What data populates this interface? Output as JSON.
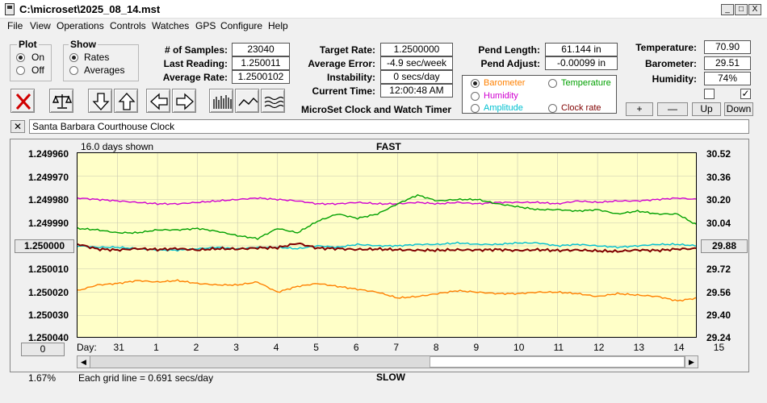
{
  "window": {
    "title": "C:\\microset\\2025_08_14.mst",
    "min": "_",
    "max": "□",
    "close": "X"
  },
  "menu": [
    "File",
    "View",
    "Operations",
    "Controls",
    "Watches",
    "GPS",
    "Configure",
    "Help"
  ],
  "plot_group": {
    "title": "Plot",
    "options": [
      "On",
      "Off"
    ],
    "selected": "On"
  },
  "show_group": {
    "title": "Show",
    "options": [
      "Rates",
      "Averages"
    ],
    "selected": "Rates"
  },
  "stats": {
    "samples_label": "# of Samples:",
    "samples": "23040",
    "last_label": "Last Reading:",
    "last": "1.250011",
    "avg_label": "Average Rate:",
    "avg": "1.2500102",
    "target_label": "Target Rate:",
    "target": "1.2500000",
    "avgerr_label": "Average Error:",
    "avgerr": "-4.9 sec/week",
    "instab_label": "Instability:",
    "instab": "0 secs/day",
    "time_label": "Current Time:",
    "time": "12:00:48 AM",
    "pendlen_label": "Pend Length:",
    "pendlen": "61.144 in",
    "pendadj_label": "Pend Adjust:",
    "pendadj": "-0.00099 in",
    "temp_label": "Temperature:",
    "temp": "70.90",
    "baro_label": "Barometer:",
    "baro": "29.51",
    "hum_label": "Humidity:",
    "hum": "74%"
  },
  "heading": "MicroSet Clock and Watch Timer",
  "series_options": [
    {
      "label": "Barometer",
      "color": "#ff8000",
      "selected": true
    },
    {
      "label": "Temperature",
      "color": "#00a000",
      "selected": false
    },
    {
      "label": "Humidity",
      "color": "#d000d0",
      "selected": false
    },
    {
      "label": "Clock rate",
      "color": "#800000",
      "selected": false
    },
    {
      "label": "Amplitude",
      "color": "#00c0d0",
      "selected": false
    }
  ],
  "adjust_buttons": {
    "plus": "+",
    "minus": "—",
    "up": "Up",
    "down": "Down"
  },
  "checkboxes": {
    "a": "",
    "b": "✓"
  },
  "clock_name": "Santa Barbara Courthouse Clock",
  "clear_btn": "✕",
  "chart": {
    "days_shown": "16.0 days shown",
    "top_label": "FAST",
    "bottom_label": "SLOW",
    "grid_note": "Each grid line = 0.691 secs/day",
    "percent": "1.67%",
    "center_left": "1.250000",
    "center_right": "29.88",
    "zero_btn": "0",
    "day_label": "Day:"
  },
  "chart_data": {
    "type": "line",
    "title": "",
    "y_left_ticks": [
      "1.249960",
      "1.249970",
      "1.249980",
      "1.249990",
      "1.250000",
      "1.250010",
      "1.250020",
      "1.250030",
      "1.250040"
    ],
    "y_right_ticks": [
      "30.52",
      "30.36",
      "30.20",
      "30.04",
      "29.88",
      "29.72",
      "29.56",
      "29.40",
      "29.24"
    ],
    "x_ticks": [
      "31",
      "1",
      "2",
      "3",
      "4",
      "5",
      "6",
      "7",
      "8",
      "9",
      "10",
      "11",
      "12",
      "13",
      "14",
      "15"
    ],
    "x": [
      0,
      0.5,
      1,
      1.5,
      2,
      2.5,
      3,
      3.5,
      4,
      4.5,
      5,
      5.5,
      6,
      6.5,
      7,
      7.5,
      8,
      8.5,
      9,
      9.5,
      10,
      10.5,
      11,
      11.5,
      12,
      12.5,
      13,
      13.5,
      14,
      14.5,
      15,
      15.5
    ],
    "series": [
      {
        "name": "Clock rate",
        "color": "#800000",
        "values": [
          1.2499992,
          1.2500014,
          1.2500018,
          1.2500012,
          1.2500016,
          1.2500012,
          1.2500018,
          1.2500012,
          1.2500014,
          1.2500009,
          1.2500008,
          1.2499989,
          1.250001,
          1.2500012,
          1.2500016,
          1.2500014,
          1.2500017,
          1.2500019,
          1.2500019,
          1.2500017,
          1.2500018,
          1.2500016,
          1.250002,
          1.2500017,
          1.250002,
          1.2500018,
          1.2500022,
          1.2500024,
          1.2500018,
          1.250002,
          1.2500014,
          1.2500012
        ]
      },
      {
        "name": "Barometer",
        "color": "#ff8000",
        "values": [
          29.57,
          29.61,
          29.62,
          29.64,
          29.63,
          29.64,
          29.62,
          29.61,
          29.61,
          29.63,
          29.56,
          29.6,
          29.62,
          29.6,
          29.58,
          29.56,
          29.52,
          29.53,
          29.55,
          29.57,
          29.56,
          29.55,
          29.55,
          29.56,
          29.56,
          29.55,
          29.53,
          29.55,
          29.54,
          29.53,
          29.5,
          29.52
        ]
      },
      {
        "name": "Temperature",
        "color": "#00a000",
        "values": [
          30.0,
          29.99,
          29.97,
          29.97,
          29.99,
          29.99,
          30.0,
          29.98,
          29.95,
          29.93,
          30.0,
          29.97,
          30.05,
          30.1,
          30.07,
          30.1,
          30.17,
          30.23,
          30.19,
          30.2,
          30.2,
          30.17,
          30.15,
          30.13,
          30.13,
          30.12,
          30.13,
          30.1,
          30.12,
          30.1,
          30.1,
          30.02
        ]
      },
      {
        "name": "Humidity",
        "color": "#d000d0",
        "values": [
          30.21,
          30.2,
          30.19,
          30.18,
          30.17,
          30.17,
          30.18,
          30.19,
          30.2,
          30.21,
          30.2,
          30.19,
          30.17,
          30.17,
          30.18,
          30.17,
          30.17,
          30.18,
          30.17,
          30.18,
          30.17,
          30.18,
          30.18,
          30.18,
          30.17,
          30.19,
          30.18,
          30.19,
          30.19,
          30.2,
          30.21,
          30.2
        ]
      },
      {
        "name": "Amplitude",
        "color": "#00c0d0",
        "values": [
          29.88,
          29.87,
          29.87,
          29.86,
          29.85,
          29.85,
          29.86,
          29.87,
          29.86,
          29.87,
          29.87,
          29.86,
          29.88,
          29.87,
          29.89,
          29.88,
          29.88,
          29.89,
          29.89,
          29.9,
          29.89,
          29.89,
          29.9,
          29.9,
          29.88,
          29.89,
          29.88,
          29.87,
          29.88,
          29.89,
          29.89,
          29.88
        ]
      }
    ],
    "ylim_left": [
      1.24996,
      1.25004
    ],
    "ylim_right": [
      29.24,
      30.52
    ],
    "grid": true
  }
}
